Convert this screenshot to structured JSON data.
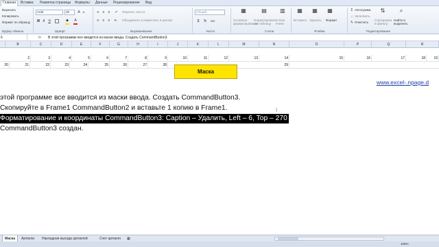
{
  "ribbon_tabs": [
    "Главная",
    "Вставка",
    "Разметка страницы",
    "Формулы",
    "Данные",
    "Рецензирование",
    "Вид"
  ],
  "clipboard": {
    "cut": "Вырезать",
    "copy": "Копировать",
    "format_painter": "Формат по образцу",
    "group": "Буфер обмена"
  },
  "font": {
    "name": "Arial",
    "size": "20",
    "group": "Шрифт",
    "bold": "Ж",
    "italic": "К",
    "underline": "Ч",
    "grow": "A",
    "shrink": "A"
  },
  "alignment": {
    "wrap": "Перенос текста",
    "merge": "Объединить и поместить в центре",
    "group": "Выравнивание"
  },
  "number": {
    "format": "Общий",
    "percent": "%",
    "thousands": "000",
    "group": "Число"
  },
  "styles": {
    "conditional": "Условное форматирование",
    "as_table": "Форматировать как таблицу",
    "cell_styles": "Стили ячеек",
    "group": "Стили"
  },
  "cells": {
    "insert": "Вставить",
    "delete": "Удалить",
    "format": "Формат",
    "group": "Ячейки"
  },
  "editing": {
    "autosum": "Автосумма",
    "fill": "Заполнить",
    "clear": "Очистить",
    "sort": "Сортировка и фильтр",
    "find": "Найти и выделить",
    "group": "Редактирование"
  },
  "formula_bar": {
    "name_box": "6",
    "fx": "fx",
    "content": "В этой программе все вводится из маски ввода. Создать CommandButton3."
  },
  "columns": [
    "B",
    "C",
    "D",
    "E",
    "F",
    "G",
    "H",
    "I",
    "J",
    "K",
    "L",
    "M",
    "N",
    "O",
    "P",
    "Q",
    "R"
  ],
  "row1": [
    "2",
    "3",
    "4",
    "5",
    "6",
    "7",
    "8",
    "9",
    "10",
    "11",
    "12",
    "13",
    "14",
    "15",
    "16",
    "17",
    "18",
    "19"
  ],
  "row2": [
    "20",
    "21",
    "22",
    "23",
    "24",
    "25",
    "26",
    "27",
    "28",
    "29"
  ],
  "mask_button": "Маска",
  "link": "www.excel-.npage.d",
  "lines": [
    "этой программе все вводится из маски ввода. Создать CommandButton3.",
    "Скопируйте в Frame1 CommandButton2 и вставьте 1 копию в Frame1.",
    "Форматирование и координаты CommandButton3: Caption – Удалить, Left – 6, Top – 270",
    "CommandButton3 создан."
  ],
  "sheet_tabs": [
    "Маска",
    "Артикли",
    "Накладная выхода артиклей",
    "Счет артикля"
  ],
  "zoom": "100%",
  "colors": {
    "mask": "#ffe400",
    "highlight": "#000000",
    "link": "#1c3fa8"
  }
}
